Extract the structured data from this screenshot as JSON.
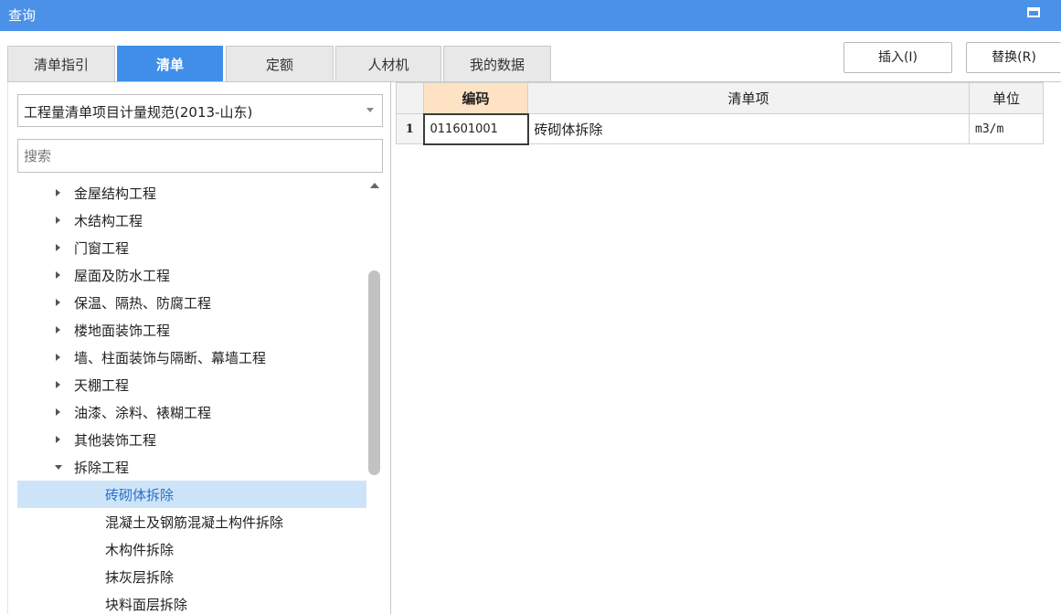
{
  "window": {
    "title": "查询"
  },
  "tabs": [
    {
      "label": "清单指引",
      "active": false
    },
    {
      "label": "清单",
      "active": true
    },
    {
      "label": "定额",
      "active": false
    },
    {
      "label": "人材机",
      "active": false
    },
    {
      "label": "我的数据",
      "active": false
    }
  ],
  "actions": {
    "insert": "插入(I)",
    "replace": "替换(R)"
  },
  "left": {
    "standard_select": "工程量清单项目计量规范(2013-山东)",
    "search_placeholder": "搜索",
    "tree": [
      {
        "label": "金屋结构工程",
        "expanded": false
      },
      {
        "label": "木结构工程",
        "expanded": false
      },
      {
        "label": "门窗工程",
        "expanded": false
      },
      {
        "label": "屋面及防水工程",
        "expanded": false
      },
      {
        "label": "保温、隔热、防腐工程",
        "expanded": false
      },
      {
        "label": "楼地面装饰工程",
        "expanded": false
      },
      {
        "label": "墙、柱面装饰与隔断、幕墙工程",
        "expanded": false
      },
      {
        "label": "天棚工程",
        "expanded": false
      },
      {
        "label": "油漆、涂料、裱糊工程",
        "expanded": false
      },
      {
        "label": "其他装饰工程",
        "expanded": false
      },
      {
        "label": "拆除工程",
        "expanded": true
      },
      {
        "label": "砖砌体拆除",
        "child": true,
        "selected": true
      },
      {
        "label": "混凝土及钢筋混凝土构件拆除",
        "child": true
      },
      {
        "label": "木构件拆除",
        "child": true
      },
      {
        "label": "抹灰层拆除",
        "child": true
      },
      {
        "label": "块料面层拆除",
        "child": true
      }
    ]
  },
  "grid": {
    "columns": {
      "code": "编码",
      "item": "清单项",
      "unit": "单位"
    },
    "rows": [
      {
        "num": "1",
        "code": "011601001",
        "item": "砖砌体拆除",
        "unit": "m3/m"
      }
    ]
  },
  "colors": {
    "accent": "#4b91e8",
    "selected_row": "#cde4f8",
    "sorted_header": "#fde2c4"
  }
}
